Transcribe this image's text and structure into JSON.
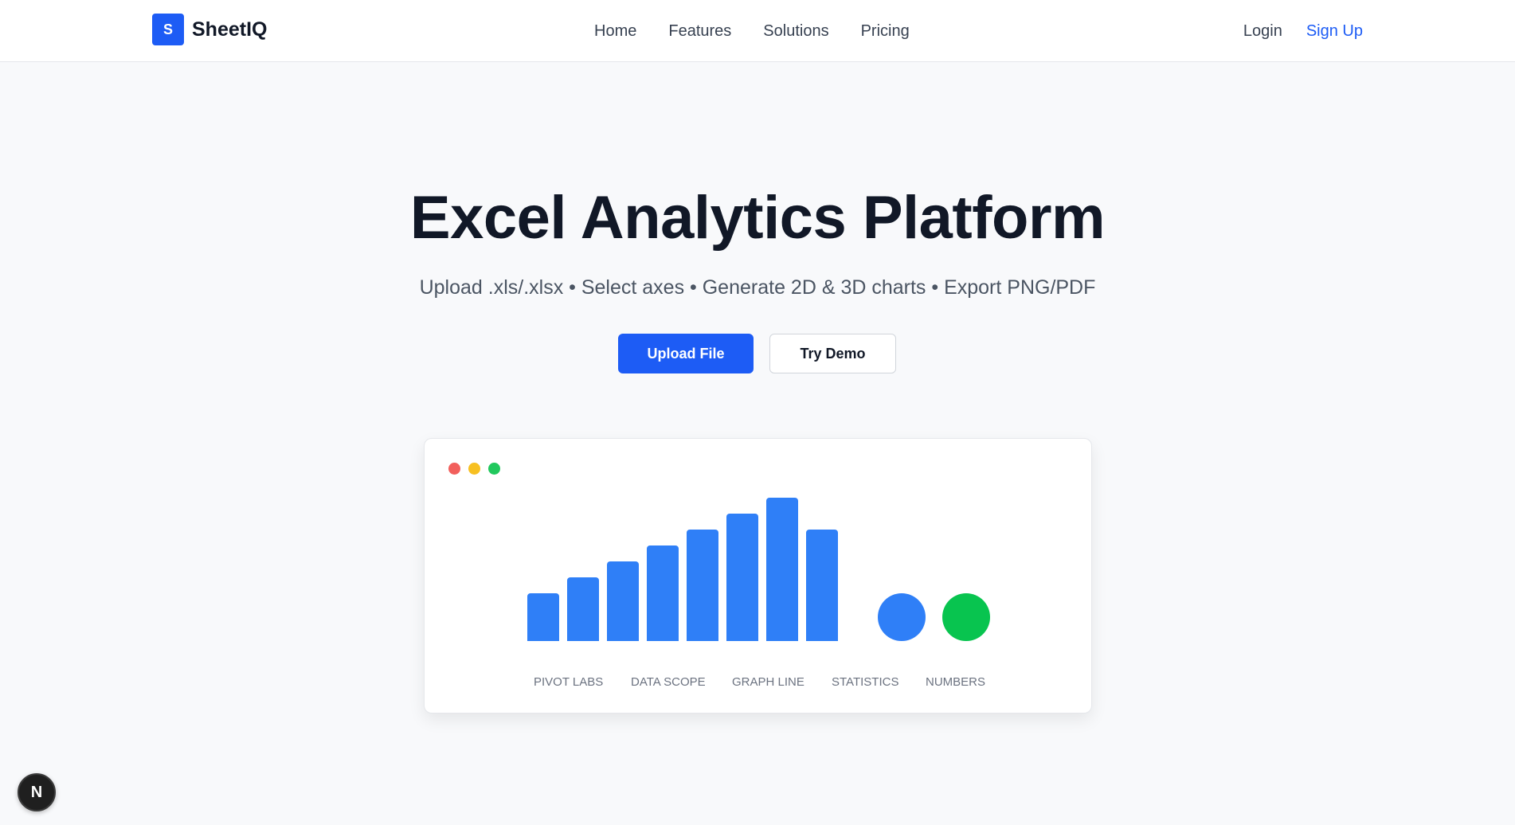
{
  "nav": {
    "brand_letter": "S",
    "brand_name": "SheetIQ",
    "links": [
      "Home",
      "Features",
      "Solutions",
      "Pricing"
    ],
    "login": "Login",
    "signup": "Sign Up"
  },
  "hero": {
    "title": "Excel Analytics Platform",
    "subtitle": "Upload .xls/.xlsx • Select axes • Generate 2D & 3D charts • Export PNG/PDF",
    "upload_label": "Upload File",
    "demo_label": "Try Demo"
  },
  "preview": {
    "window_dot_colors": [
      "#f25f5c",
      "#f7c021",
      "#21c85d"
    ],
    "accent_blue": "#2f7ff7",
    "accent_green": "#08c44f"
  },
  "chart_data": {
    "type": "bar",
    "values": [
      3,
      4,
      5,
      6,
      7,
      8,
      9,
      7
    ],
    "bubbles": [
      "#2f7ff7",
      "#08c44f"
    ],
    "categories": [
      "PIVOT LABS",
      "DATA SCOPE",
      "GRAPH LINE",
      "STATISTICS",
      "NUMBERS"
    ]
  },
  "badge": {
    "letter": "N"
  }
}
